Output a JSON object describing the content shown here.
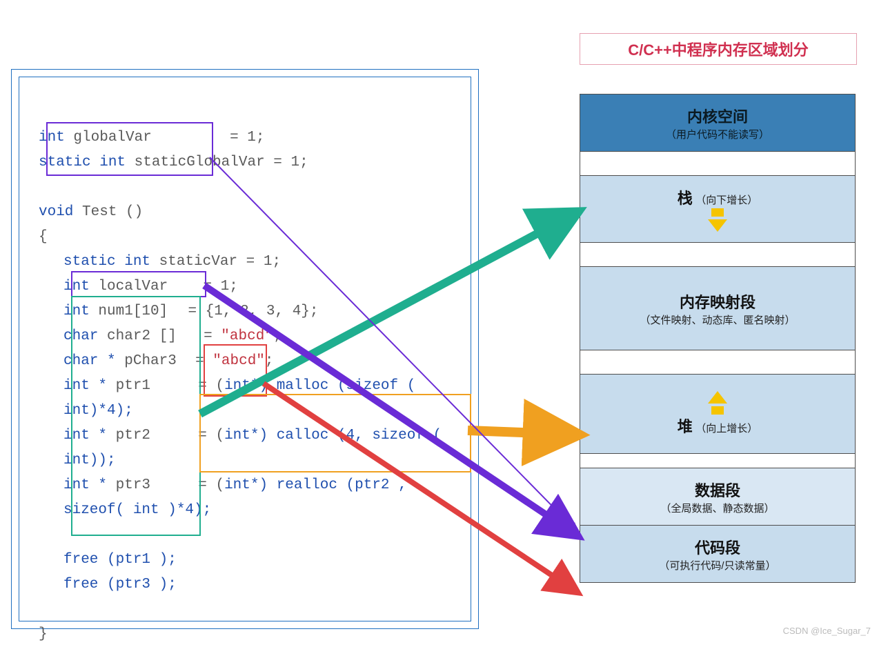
{
  "title": "C/C++中程序内存区域划分",
  "code": {
    "globalVar": {
      "type": "int",
      "name": "globalVar",
      "eq": "= 1;"
    },
    "staticGlobal": {
      "type": "static int",
      "name": "staticGlobalVar",
      "eq": "= 1;"
    },
    "funcDecl": {
      "type": "void",
      "name": "Test ()"
    },
    "lbrace": "{",
    "staticVar": {
      "type": "static int",
      "name": "staticVar",
      "eq": "= 1;"
    },
    "localVar": {
      "type": "int",
      "name": "localVar",
      "eq": "= 1;"
    },
    "num1": {
      "type": "int",
      "name": "num1[10]",
      "eq": "= {1, 2, 3, 4};"
    },
    "char2": {
      "type": "char",
      "name": "char2 []",
      "eq": "=",
      "str": "\"abcd\"",
      "semi": ";"
    },
    "pChar3": {
      "type": "char *",
      "name": "pChar3",
      "eq": "=",
      "str": "\"abcd\"",
      "semi": ";"
    },
    "ptr1": {
      "type": "int *",
      "name": "ptr1",
      "eq": "= (",
      "cast": "int*",
      "expr": ") malloc (sizeof ( int)*4);"
    },
    "ptr2": {
      "type": "int *",
      "name": "ptr2",
      "eq": "= (",
      "cast": "int*",
      "expr": ") calloc (4, sizeof ( int));"
    },
    "ptr3": {
      "type": "int *",
      "name": "ptr3",
      "eq": "= (",
      "cast": "int*",
      "expr": ") realloc (ptr2 , sizeof( int )*4);"
    },
    "free1": "free (ptr1 );",
    "free3": "free (ptr3 );",
    "rbrace": "}"
  },
  "memory": {
    "kernel": {
      "title": "内核空间",
      "sub": "（用户代码不能读写）"
    },
    "stack": {
      "title": "栈",
      "sub": "（向下增长）"
    },
    "mmap": {
      "title": "内存映射段",
      "sub": "（文件映射、动态库、匿名映射）"
    },
    "heap": {
      "title": "堆",
      "sub": "（向上增长）"
    },
    "data": {
      "title": "数据段",
      "sub": "（全局数据、静态数据）"
    },
    "text": {
      "title": "代码段",
      "sub": "（可执行代码/只读常量）"
    }
  },
  "arrows": [
    {
      "name": "green-arrow",
      "color": "#1fae8f",
      "from": "code.localVars",
      "to": "memory.stack"
    },
    {
      "name": "orange-arrow",
      "color": "#f0a020",
      "from": "code.mallocCalls",
      "to": "memory.heap"
    },
    {
      "name": "purple-arrow",
      "color": "#6a2bd6",
      "from": "code.staticVars",
      "to": "memory.data"
    },
    {
      "name": "red-arrow",
      "color": "#e14040",
      "from": "code.stringLiteral",
      "to": "memory.text"
    }
  ],
  "watermark": "CSDN @Ice_Sugar_7"
}
